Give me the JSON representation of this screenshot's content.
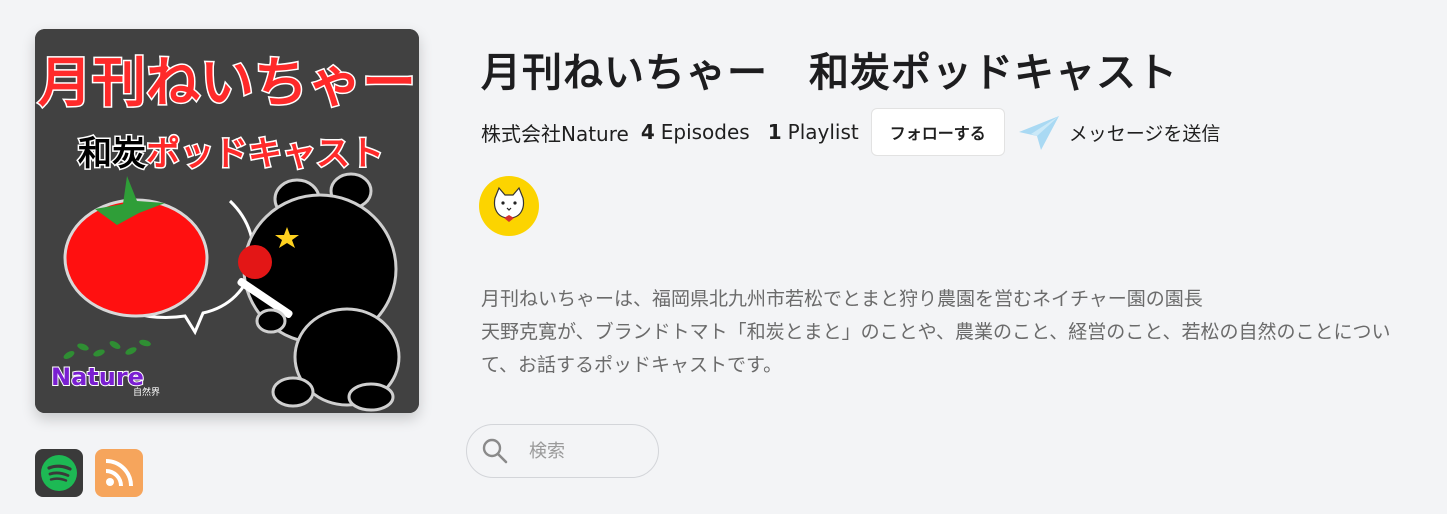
{
  "podcast": {
    "title": "月刊ねいちゃー　和炭ポッドキャスト",
    "publisher": "株式会社Nature",
    "episodes_count": "4",
    "episodes_label": "Episodes",
    "playlists_count": "1",
    "playlists_label": "Playlist",
    "follow_label": "フォローする",
    "message_label": "メッセージを送信",
    "description_lines": [
      "月刊ねいちゃーは、福岡県北九州市若松でとまと狩り農園を営むネイチャー園の園長",
      "天野克寛が、ブランドトマト「和炭とまと」のことや、農業のこと、経営のこと、若松の自然のことについ",
      "て、お話するポッドキャストです。"
    ]
  },
  "cover": {
    "title_line1": "月刊ねいちゃー",
    "title_line2a": "和炭",
    "title_line2b": "ポッドキャスト",
    "logo_text": "Nature",
    "logo_sub": "自然界"
  },
  "platforms": [
    {
      "name": "spotify",
      "icon": "spotify-icon",
      "color": "#1db954"
    },
    {
      "name": "rss",
      "icon": "rss-icon",
      "color": "#f6a55c"
    }
  ],
  "search": {
    "placeholder": "検索"
  },
  "colors": {
    "background": "#f3f4f6",
    "cover_bg": "#414141",
    "accent_red": "#ff2a2a",
    "avatar_bg": "#fcd400",
    "message_icon": "#a9d9f3"
  }
}
